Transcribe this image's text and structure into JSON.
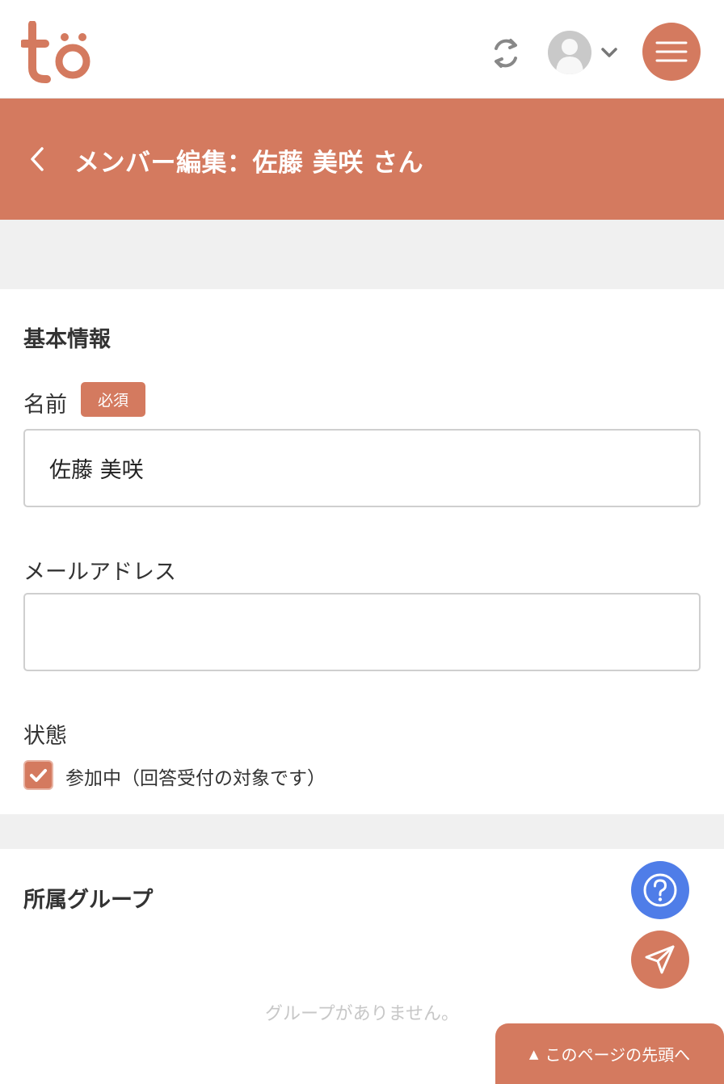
{
  "header": {
    "logo_text": "to",
    "brand_color": "#d47a5f",
    "icons": [
      "sync-icon",
      "user-avatar-icon",
      "chevron-down-icon",
      "hamburger-menu-icon"
    ]
  },
  "title_bar": {
    "back_icon": "chevron-left-icon",
    "title": "メンバー編集：佐藤 美咲 さん"
  },
  "basic_info": {
    "section_title": "基本情報",
    "name": {
      "label": "名前",
      "required_badge": "必須",
      "value": "佐藤 美咲"
    },
    "email": {
      "label": "メールアドレス",
      "value": ""
    },
    "status": {
      "label": "状態",
      "checkbox_checked": true,
      "checkbox_label": "参加中（回答受付の対象です）"
    }
  },
  "groups": {
    "section_title": "所属グループ",
    "empty_message": "グループがありません。"
  },
  "floating": {
    "help_icon": "question-circle-icon",
    "send_icon": "paper-plane-icon",
    "help_color": "#4f7de8"
  },
  "back_to_top": {
    "arrow": "▲",
    "label": "このページの先頭へ"
  }
}
